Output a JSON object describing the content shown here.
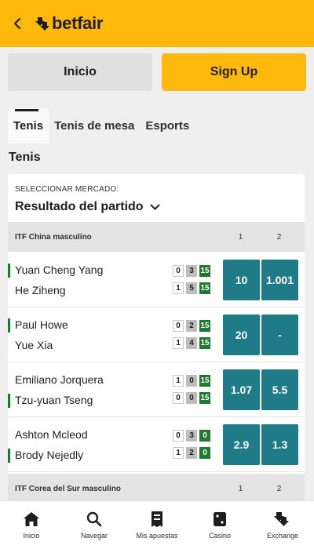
{
  "header": {
    "brand": "betfair"
  },
  "auth": {
    "login_label": "Inicio",
    "signup_label": "Sign Up"
  },
  "tabs": [
    {
      "label": "Tenis",
      "active": true
    },
    {
      "label": "Tenis de mesa",
      "active": false
    },
    {
      "label": "Esports",
      "active": false
    }
  ],
  "section_title": "Tenis",
  "market": {
    "label": "SELECCIONAR MERCADO:",
    "selected": "Resultado del partido"
  },
  "competitions": [
    {
      "name": "ITF China masculino",
      "col1": "1",
      "col2": "2",
      "matches": [
        {
          "p1": "Yuan Cheng Yang",
          "p2": "He Ziheng",
          "serving": 1,
          "s1": [
            "0",
            "3",
            "15"
          ],
          "s2": [
            "1",
            "5",
            "15"
          ],
          "odd1": "10",
          "odd2": "1.001"
        },
        {
          "p1": "Paul Howe",
          "p2": "Yue Xia",
          "serving": 1,
          "s1": [
            "0",
            "2",
            "15"
          ],
          "s2": [
            "1",
            "4",
            "15"
          ],
          "odd1": "20",
          "odd2": "-"
        },
        {
          "p1": "Emiliano Jorquera",
          "p2": "Tzu-yuan Tseng",
          "serving": 2,
          "s1": [
            "1",
            "0",
            "15"
          ],
          "s2": [
            "0",
            "0",
            "15"
          ],
          "odd1": "1.07",
          "odd2": "5.5"
        },
        {
          "p1": "Ashton Mcleod",
          "p2": "Brody Nejedly",
          "serving": 2,
          "s1": [
            "0",
            "3",
            "0"
          ],
          "s2": [
            "1",
            "2",
            "0"
          ],
          "odd1": "2.9",
          "odd2": "1.3"
        }
      ]
    },
    {
      "name": "ITF Corea del Sur masculino",
      "col1": "1",
      "col2": "2"
    }
  ],
  "bottom_nav": [
    {
      "label": "Inicio",
      "icon": "home-icon"
    },
    {
      "label": "Navegar",
      "icon": "search-icon"
    },
    {
      "label": "Mis apuestas",
      "icon": "bets-slip-icon"
    },
    {
      "label": "Casino",
      "icon": "dice-icon"
    },
    {
      "label": "Exchange",
      "icon": "exchange-icon"
    }
  ],
  "colors": {
    "brand_yellow": "#ffb80c",
    "odds_teal": "#1f7b88",
    "score_green": "#1e7a2d"
  }
}
